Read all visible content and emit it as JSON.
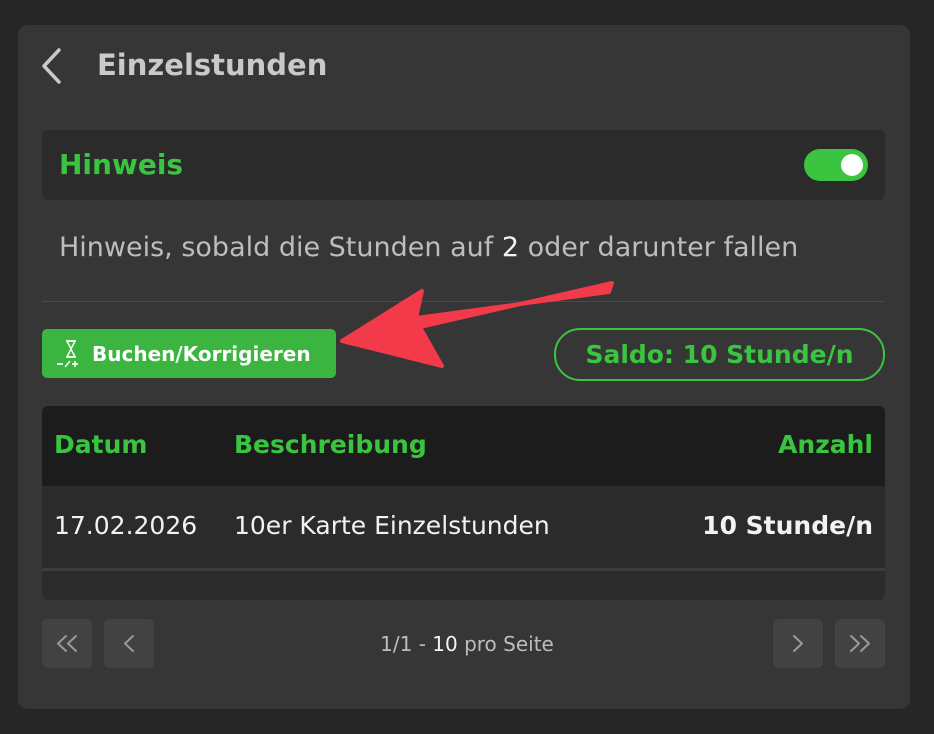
{
  "header": {
    "title": "Einzelstunden",
    "back_icon": "chevron-left-icon"
  },
  "notice": {
    "label": "Hinweis",
    "toggle_on": true,
    "description_pre": "Hinweis, sobald die Stunden auf",
    "description_value": "2",
    "description_post": "oder darunter fallen"
  },
  "actions": {
    "book_label": "Buchen/Korrigieren",
    "book_icon": "hourglass-plus-minus-icon",
    "saldo_label": "Saldo: 10 Stunde/n"
  },
  "table": {
    "columns": [
      "Datum",
      "Beschreibung",
      "Anzahl"
    ],
    "rows": [
      {
        "date": "17.02.2026",
        "description": "10er Karte Einzelstunden",
        "amount": "10 Stunde/n"
      }
    ]
  },
  "pagination": {
    "page": "1/1",
    "separator": "-",
    "per_page": "10",
    "per_page_label": "pro Seite"
  },
  "colors": {
    "accent": "#3bc43f",
    "annotation_arrow": "#f23a4a",
    "panel": "#363636",
    "background": "#262626"
  }
}
